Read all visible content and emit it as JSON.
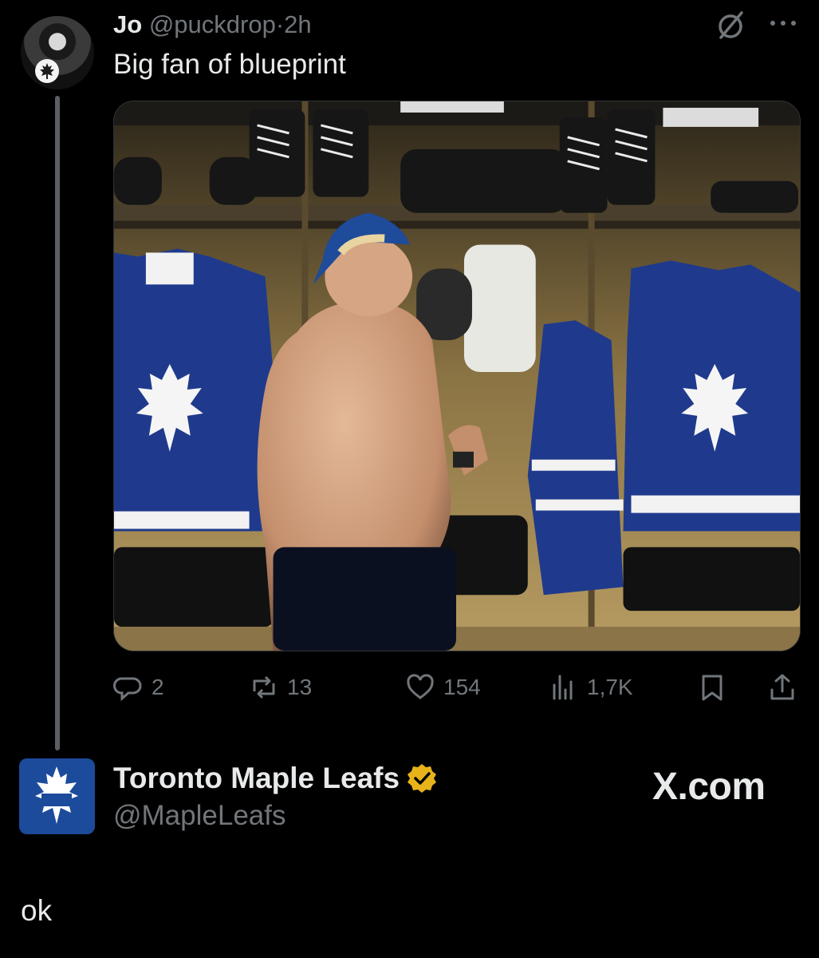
{
  "tweet": {
    "author_name": "Jo",
    "author_handle": "@puckdrop",
    "separator": "·",
    "time": "2h",
    "text": "Big fan of blueprint",
    "media_icon": "locker-room-photo"
  },
  "actions": {
    "reply_count": "2",
    "repost_count": "13",
    "like_count": "154",
    "views_count": "1,7K"
  },
  "embed": {
    "account_name": "Toronto Maple Leafs",
    "account_handle": "@MapleLeafs",
    "verified_color": "#e8b21a",
    "source_label": "X.com"
  },
  "caption": "ok",
  "colors": {
    "background": "#000000",
    "muted": "#71767b",
    "text": "#e7e9ea",
    "leafs_blue": "#1d4b9b"
  }
}
